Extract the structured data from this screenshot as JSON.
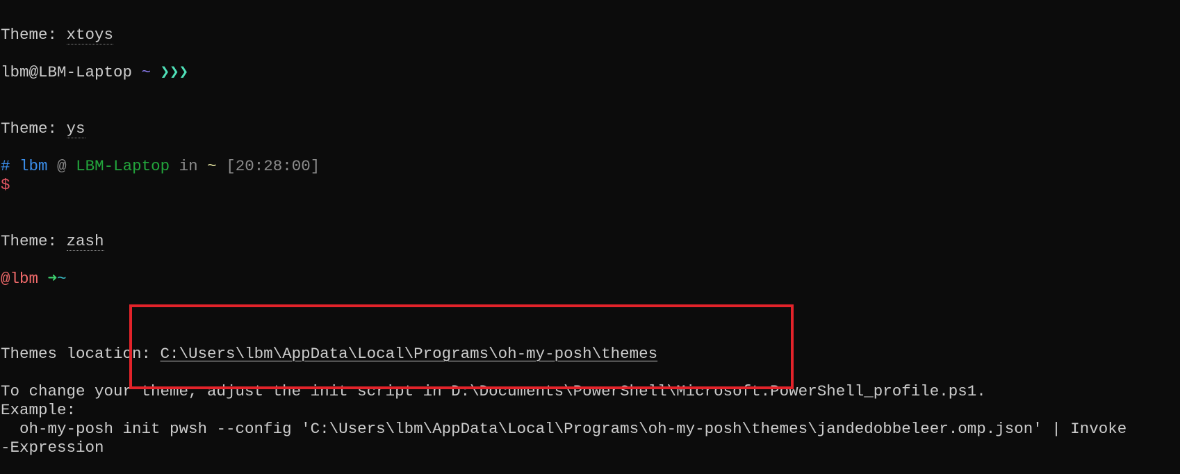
{
  "themes": [
    {
      "label": "Theme: ",
      "name": "xtoys",
      "prompt": {
        "user_host": "lbm@LBM-Laptop",
        "dir": "~",
        "chevrons": "❯❯❯"
      }
    },
    {
      "label": "Theme: ",
      "name": "ys",
      "prompt": {
        "hash": "#",
        "user": "lbm",
        "at": "@",
        "host": "LBM-Laptop",
        "in": "in",
        "dir": "~",
        "time": "[20:28:00]",
        "dollar": "$"
      }
    },
    {
      "label": "Theme: ",
      "name": "zash",
      "prompt": {
        "user": "@lbm",
        "arrow": "➜",
        "dir": "~"
      }
    }
  ],
  "footer": {
    "location_label": "Themes location: ",
    "location_path": "C:\\Users\\lbm\\AppData\\Local\\Programs\\oh-my-posh\\themes",
    "change_text": "To change your theme, adjust the init script in D:\\Documents\\PowerShell\\Microsoft.PowerShell_profile.ps1.",
    "example_label": "Example:",
    "example_command": "  oh-my-posh init pwsh --config 'C:\\Users\\lbm\\AppData\\Local\\Programs\\oh-my-posh\\themes\\jandedobbeleer.omp.json' | Invoke",
    "example_command_wrap": "-Expression"
  },
  "colors": {
    "background": "#0c0c0c",
    "text": "#cccccc",
    "highlight_box": "#e3232a"
  }
}
